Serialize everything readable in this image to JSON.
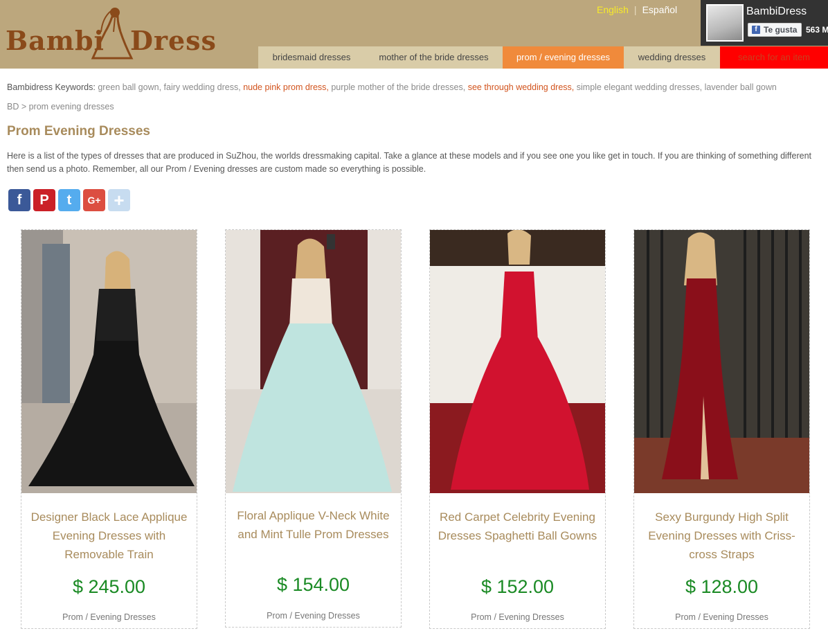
{
  "brand": {
    "logo_text_left": "Bambi",
    "logo_text_right": "Dress"
  },
  "languages": {
    "english": "English",
    "spanish": "Español",
    "separator": "|"
  },
  "facebook": {
    "page_name": "BambiDress",
    "like_label": "Te gusta",
    "like_count": "563 M"
  },
  "nav": {
    "items": [
      {
        "label": "bridesmaid dresses"
      },
      {
        "label": "mother of the bride dresses"
      },
      {
        "label": "prom / evening dresses"
      },
      {
        "label": "wedding dresses"
      },
      {
        "label": "search for an item"
      }
    ],
    "active_color": "#f08a3b",
    "search_color": "#ff0000"
  },
  "keywords": {
    "label": "Bambidress Keywords:",
    "items": [
      "green ball gown,",
      "fairy wedding dress,",
      "nude pink prom dress,",
      "purple mother of the bride dresses,",
      "see through wedding dress,",
      "simple elegant wedding dresses,",
      "lavender ball gown"
    ]
  },
  "breadcrumb": "BD > prom evening dresses",
  "page_title": "Prom Evening Dresses",
  "intro": "Here is a list of the types of dresses that are produced in SuZhou, the worlds dressmaking capital. Take a glance at these models and if you see one you like get in touch. If you are thinking of something different then send us a photo. Remember, all our Prom / Evening dresses are custom made so everything is possible.",
  "share": {
    "facebook": "f",
    "pinterest": "P",
    "twitter": "t",
    "googleplus": "G+",
    "more": "+"
  },
  "products": [
    {
      "name": "Designer Black Lace Applique Evening Dresses with Removable Train",
      "price": "$ 245.00",
      "category": "Prom / Evening Dresses"
    },
    {
      "name": "Floral Applique V-Neck White and Mint Tulle Prom Dresses",
      "price": "$ 154.00",
      "category": "Prom / Evening Dresses"
    },
    {
      "name": "Red Carpet Celebrity Evening Dresses Spaghetti Ball Gowns",
      "price": "$ 152.00",
      "category": "Prom / Evening Dresses"
    },
    {
      "name": "Sexy Burgundy High Split Evening Dresses with Criss-cross Straps",
      "price": "$ 128.00",
      "category": "Prom / Evening Dresses"
    }
  ],
  "colors": {
    "header_bg": "#bca77d",
    "title": "#a88b5c",
    "price": "#1a8a24"
  }
}
